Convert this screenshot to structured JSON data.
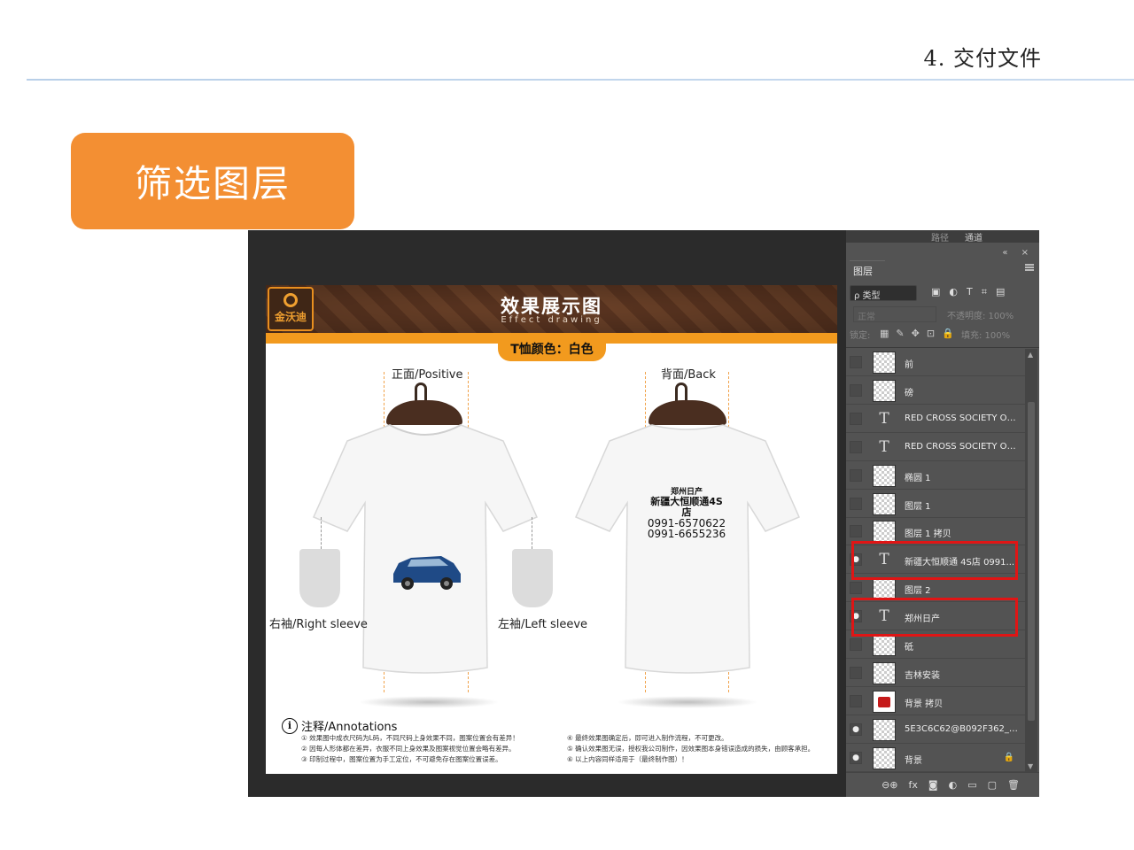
{
  "slide": {
    "title": "4. 交付文件",
    "section_label": "筛选图层"
  },
  "document": {
    "logo_text": "金沃迪",
    "title": "效果展示图",
    "subtitle": "Effect drawing",
    "color_tag": "T恤颜色：白色",
    "front_label": "正面/Positive",
    "back_label": "背面/Back",
    "right_sleeve_label": "右袖/Right sleeve",
    "left_sleeve_label": "左袖/Left sleeve",
    "back_print": {
      "line1": "郑州日产",
      "line2": "新疆大恒顺通4S店",
      "line3": "0991-6570622",
      "line4": "0991-6655236"
    },
    "notes_title": "注释/Annotations",
    "notes_left": [
      "① 效果图中成衣尺码为L码，不同尺码上身效果不同，图案位置会有差异！",
      "② 因每人形体都在差异，衣服不同上身效果及图案视觉位置会略有差异。",
      "③ 印制过程中，图案位置为手工定位，不可避免存在图案位置误差。"
    ],
    "notes_right": [
      "④ 最终效果图确定后，即可进入制作流程，不可更改。",
      "⑤ 确认效果图无误，授权我公司制作，因效果图本身错误造成的损失，由顾客承担。",
      "⑥ 以上内容同样适用于（最终制作图）！"
    ]
  },
  "photoshop": {
    "top_tabs": [
      "路径",
      "通道"
    ],
    "window_controls": "«  ×",
    "panel_tab": "图层",
    "kind_filter": "ρ 类型",
    "filter_icons": [
      "▣",
      "◐",
      "T",
      "⌗",
      "▤"
    ],
    "blend_mode": "正常",
    "opacity_label": "不透明度: 100%",
    "lock_label": "锁定:",
    "lock_icons": [
      "▦",
      "✎",
      "✥",
      "⊡",
      "🔒"
    ],
    "fill_label": "填充: 100%",
    "layers": [
      {
        "name": "前",
        "visible": false,
        "thumb": "smart"
      },
      {
        "name": "磅",
        "visible": false,
        "thumb": "smart"
      },
      {
        "name": "RED CROSS SOCIETY OF ...",
        "visible": false,
        "thumb": "type"
      },
      {
        "name": "RED CROSS SOCIETY OF ...",
        "visible": false,
        "thumb": "type"
      },
      {
        "name": "椭圆 1",
        "visible": false,
        "thumb": "smart"
      },
      {
        "name": "图层 1",
        "visible": false,
        "thumb": "smart"
      },
      {
        "name": "图层 1 拷贝",
        "visible": false,
        "thumb": "smart"
      },
      {
        "name": "新疆大恒顺通 4S店 0991...",
        "visible": true,
        "thumb": "type"
      },
      {
        "name": "图层 2",
        "visible": false,
        "thumb": "smart"
      },
      {
        "name": "郑州日产",
        "visible": true,
        "thumb": "type"
      },
      {
        "name": "砥",
        "visible": false,
        "thumb": "smart"
      },
      {
        "name": "吉林安装",
        "visible": false,
        "thumb": "smart"
      },
      {
        "name": "背景 拷贝",
        "visible": false,
        "thumb": "red"
      },
      {
        "name": "5E3C6C62@B092F362_89...",
        "visible": true,
        "thumb": "smart"
      },
      {
        "name": "背景",
        "visible": true,
        "thumb": "smart",
        "locked": true
      }
    ],
    "footer_icons": [
      "⊖⊕",
      "fx",
      "◙",
      "◐",
      "▭",
      "▢",
      "🗑"
    ],
    "highlighted_layers": [
      "新疆大恒顺通 4S店 0991...",
      "郑州日产"
    ]
  }
}
